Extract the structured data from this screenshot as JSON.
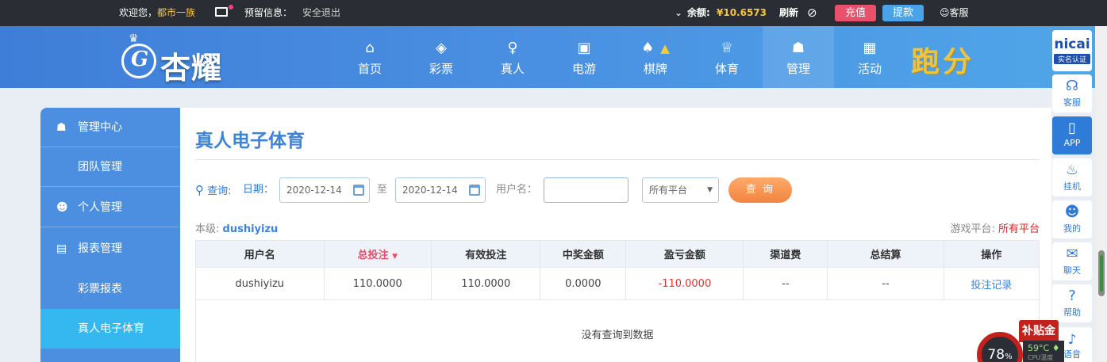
{
  "topbar": {
    "welcome": "欢迎您，",
    "username": "都市一族",
    "reserve_info": "预留信息：",
    "logout": "安全退出",
    "balance_label": "余额:",
    "balance_value": "¥10.6573",
    "refresh": "刷新",
    "recharge": "充值",
    "withdraw": "提款",
    "service": "客服"
  },
  "header": {
    "logo_text": "杏耀",
    "nav": [
      {
        "label": "首页",
        "icon": "home-icon"
      },
      {
        "label": "彩票",
        "icon": "lottery-icon"
      },
      {
        "label": "真人",
        "icon": "live-dealer-icon"
      },
      {
        "label": "电游",
        "icon": "slot-machine-icon"
      },
      {
        "label": "棋牌",
        "icon": "cards-icon"
      },
      {
        "label": "体育",
        "icon": "trophy-icon"
      },
      {
        "label": "管理",
        "icon": "users-icon"
      },
      {
        "label": "活动",
        "icon": "gift-icon"
      }
    ],
    "active_nav": "管理",
    "promo_text": "跑分"
  },
  "right_float": {
    "logo_text": "nicai",
    "logo_badge": "实名认证",
    "items": [
      {
        "label": "客服",
        "icon": "headset-icon"
      },
      {
        "label": "APP",
        "icon": "phone-icon"
      },
      {
        "label": "挂机",
        "icon": "money-bag-icon"
      },
      {
        "label": "我的",
        "icon": "user-icon"
      },
      {
        "label": "聊天",
        "icon": "chat-icon"
      },
      {
        "label": "帮助",
        "icon": "help-icon"
      },
      {
        "label": "语音",
        "icon": "speaker-icon"
      }
    ]
  },
  "left_menu": {
    "items": [
      {
        "label": "管理中心",
        "type": "group",
        "icon": "users-icon"
      },
      {
        "label": "团队管理",
        "type": "sub"
      },
      {
        "label": "个人管理",
        "type": "group",
        "icon": "user-icon"
      },
      {
        "label": "报表管理",
        "type": "group",
        "icon": "document-icon"
      },
      {
        "label": "彩票报表",
        "type": "sub"
      },
      {
        "label": "真人电子体育",
        "type": "sub",
        "active": true
      }
    ]
  },
  "main": {
    "title": "真人电子体育",
    "query": {
      "label": "查询:",
      "date_label": "日期：",
      "date_from": "2020-12-14",
      "to_label": "至",
      "date_to": "2020-12-14",
      "username_label": "用户名：",
      "username_value": "",
      "platform_selected": "所有平台",
      "submit": "查 询"
    },
    "level_label": "本级:",
    "level_value": "dushiyizu",
    "platform_label": "游戏平台:",
    "platform_value": "所有平台",
    "table": {
      "columns": [
        "用户名",
        "总投注",
        "有效投注",
        "中奖金额",
        "盈亏金额",
        "渠道费",
        "总结算",
        "操作"
      ],
      "sorted_column": "总投注",
      "rows": [
        [
          "dushiyizu",
          "110.0000",
          "110.0000",
          "0.0000",
          "-110.0000",
          "--",
          "--",
          "投注记录"
        ]
      ],
      "empty_message": "没有查询到数据"
    }
  },
  "overlay": {
    "subsidy": "补贴金",
    "cpu_percent": "78",
    "cpu_unit": "%",
    "temperature": "59°C",
    "temperature_label": "CPU温度"
  },
  "colors": {
    "accent": "#3d84d9",
    "recharge": "#e8506b",
    "withdraw": "#4aa3e8",
    "negative": "#e8302f",
    "query_button": "#f28440"
  }
}
